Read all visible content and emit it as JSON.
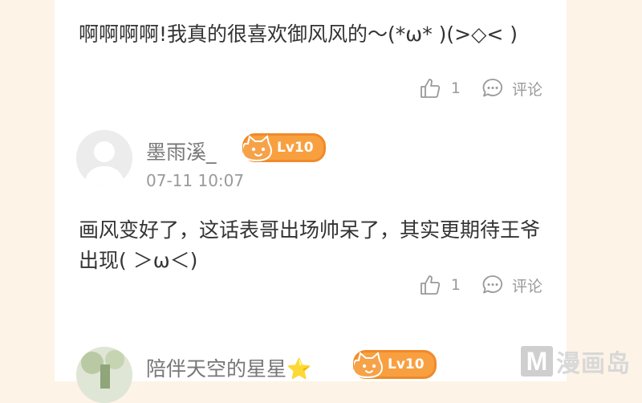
{
  "comments": [
    {
      "text": "啊啊啊啊!我真的很喜欢御风风的～(*ω* )(>◇< )",
      "like_count": "1",
      "comment_label": "评论"
    },
    {
      "username": "墨雨溪_",
      "level": "Lv10",
      "timestamp": "07-11 10:07",
      "text": "画风变好了，这话表哥出场帅呆了，其实更期待王爷出现( ＞ω＜)",
      "like_count": "1",
      "comment_label": "评论"
    },
    {
      "username": "陪伴天空的星星⭐",
      "level": "Lv10"
    }
  ],
  "watermark": {
    "logo_letter": "M",
    "text": "漫画岛"
  },
  "colors": {
    "background": "#fdf3e7",
    "card": "#ffffff",
    "badge": "#f8a040",
    "text_primary": "#333333",
    "text_secondary": "#999999"
  }
}
